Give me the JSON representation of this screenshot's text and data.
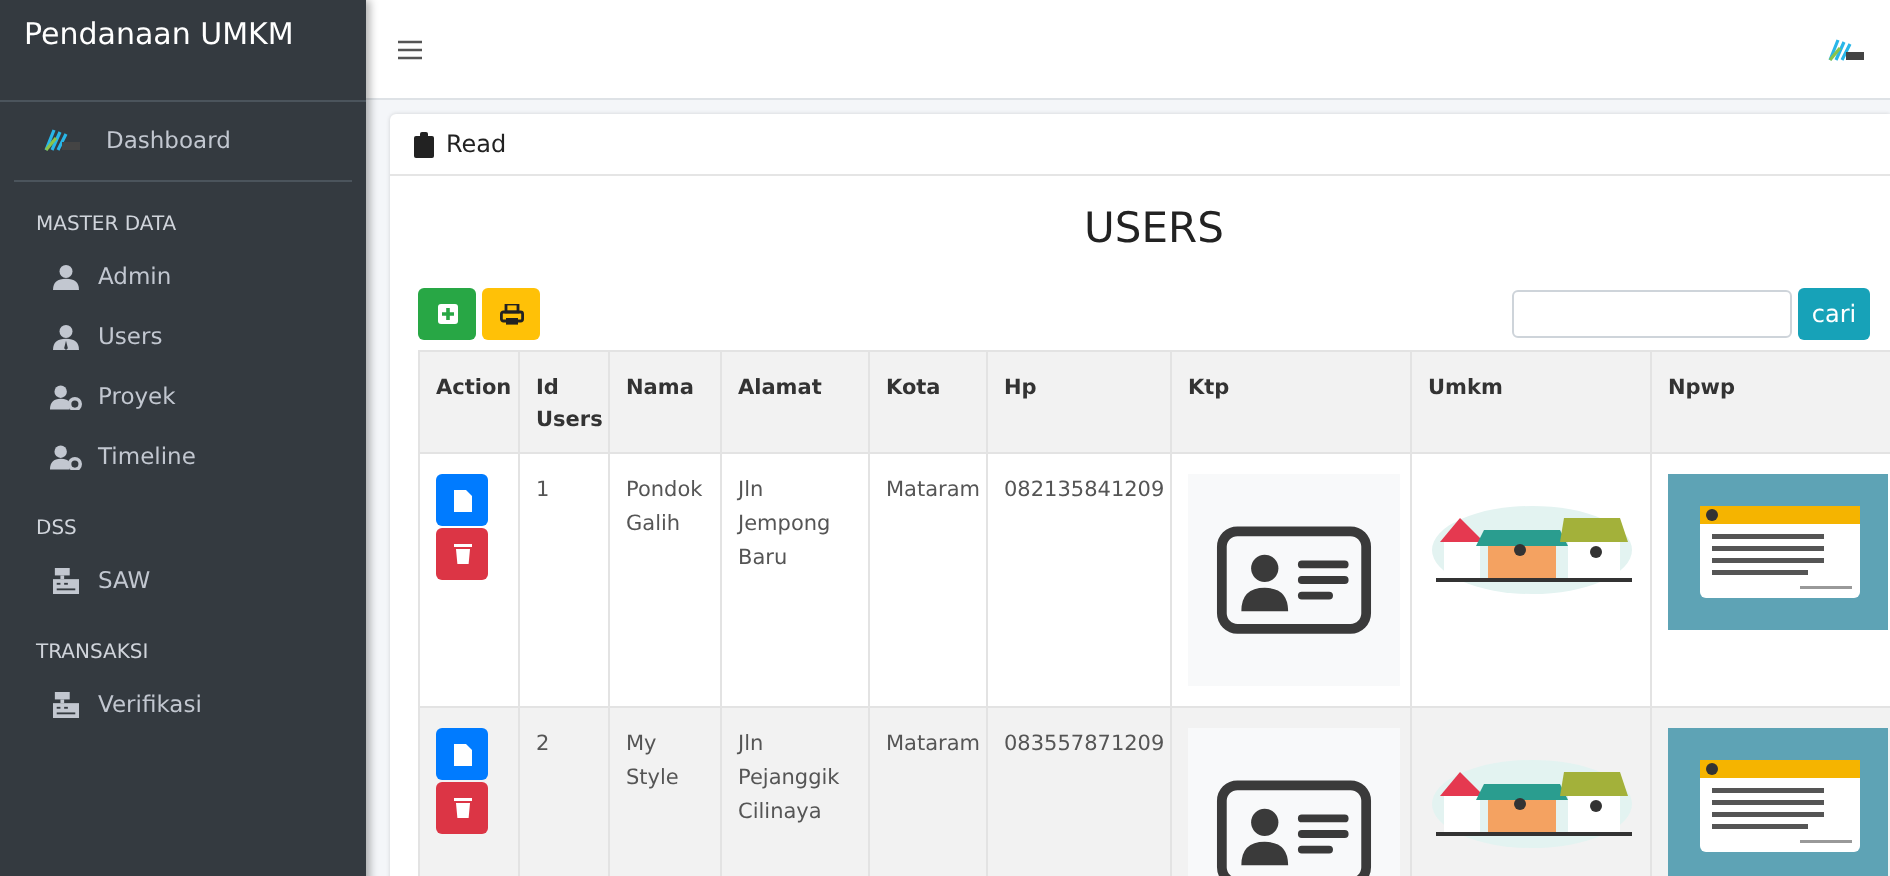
{
  "sidebar": {
    "brand": "Pendanaan UMKM",
    "dashboard": "Dashboard",
    "sections": [
      {
        "heading": "MASTER DATA",
        "items": [
          {
            "label": "Admin",
            "kind": "user"
          },
          {
            "label": "Users",
            "kind": "staff"
          },
          {
            "label": "Proyek",
            "kind": "manage"
          },
          {
            "label": "Timeline",
            "kind": "manage"
          }
        ]
      },
      {
        "heading": "DSS",
        "items": [
          {
            "label": "SAW",
            "kind": "register"
          }
        ]
      },
      {
        "heading": "TRANSAKSI",
        "items": [
          {
            "label": "Verifikasi",
            "kind": "register"
          }
        ]
      }
    ]
  },
  "card": {
    "header": "Read",
    "title": "USERS",
    "search": {
      "button": "cari"
    }
  },
  "table": {
    "columns": [
      "Action",
      "Id Users",
      "Nama",
      "Alamat",
      "Kota",
      "Hp",
      "Ktp",
      "Umkm",
      "Npwp"
    ],
    "rows": [
      {
        "id": "1",
        "nama": "Pondok Galih",
        "alamat": "Jln Jempong Baru",
        "kota": "Mataram",
        "hp": "082135841209"
      },
      {
        "id": "2",
        "nama": "My Style",
        "alamat": "Jln Pejanggik Cilinaya",
        "kota": "Mataram",
        "hp": "083557871209"
      }
    ]
  }
}
